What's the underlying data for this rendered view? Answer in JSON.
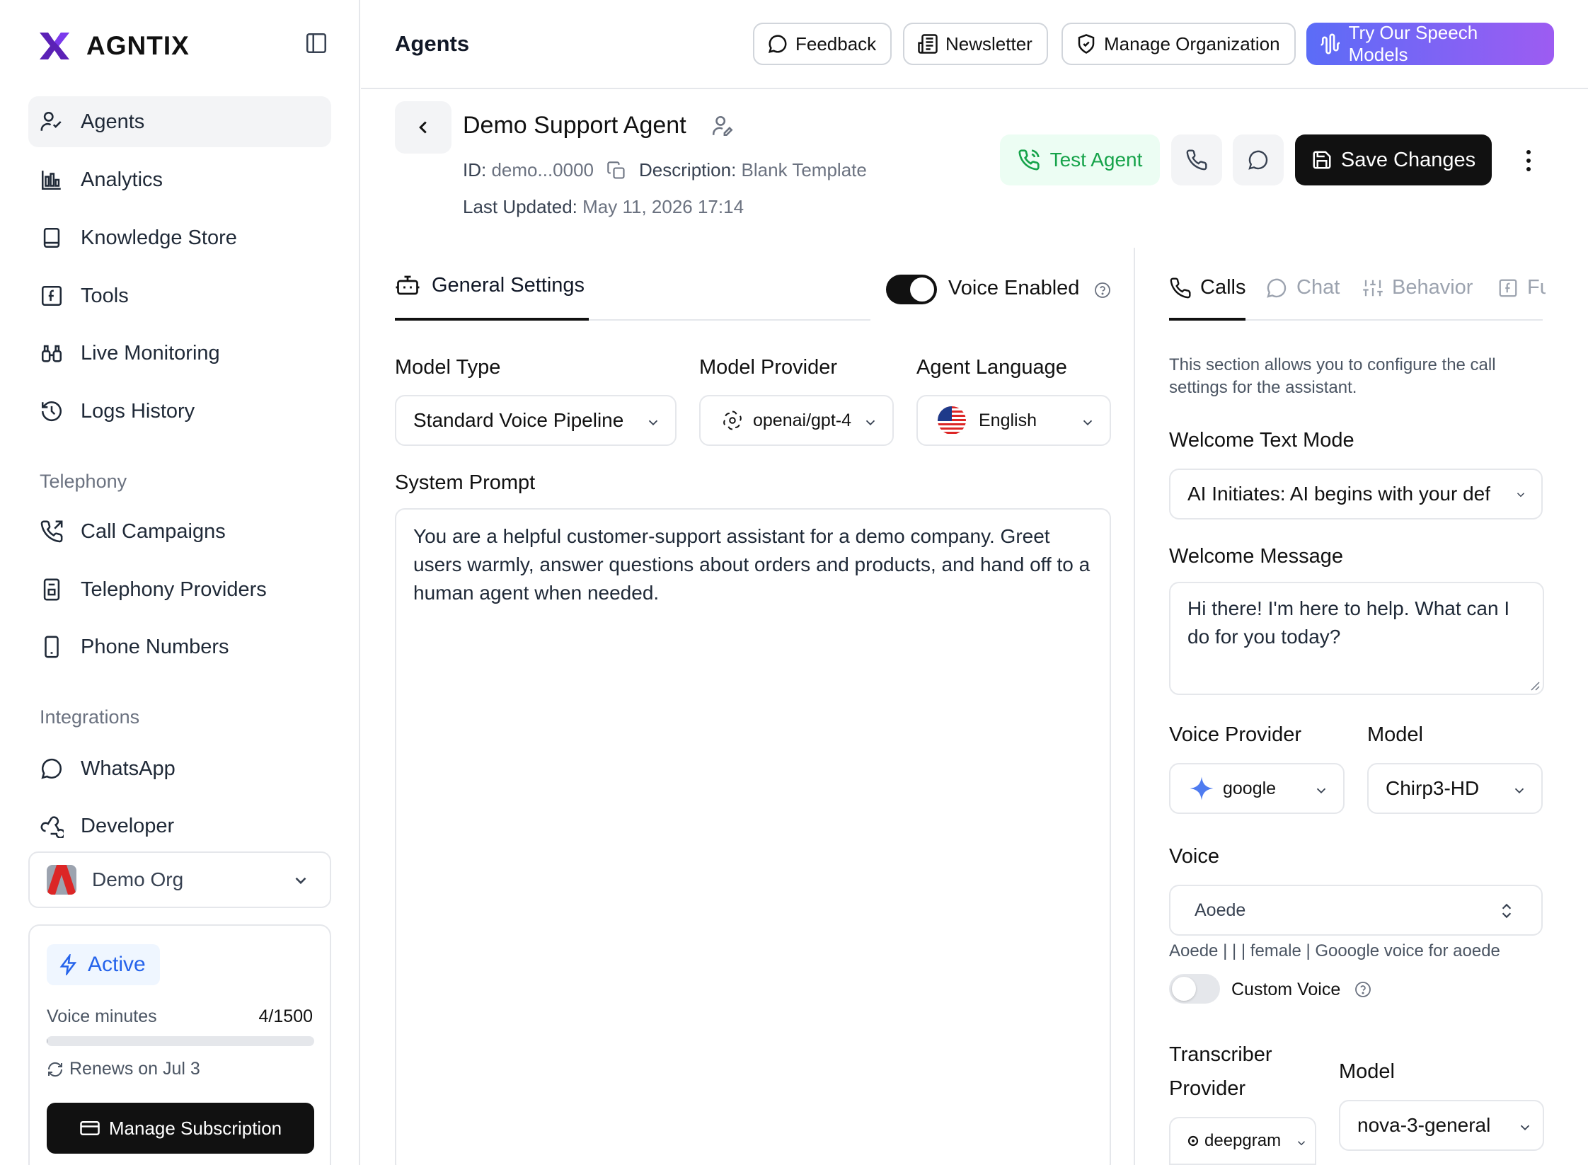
{
  "brand": {
    "name": "AGNTIX"
  },
  "sidebar": {
    "items": [
      {
        "label": "Agents",
        "icon": "agents-icon"
      },
      {
        "label": "Analytics",
        "icon": "analytics-icon"
      },
      {
        "label": "Knowledge Store",
        "icon": "book-icon"
      },
      {
        "label": "Tools",
        "icon": "function-icon"
      },
      {
        "label": "Live Monitoring",
        "icon": "binoculars-icon"
      },
      {
        "label": "Logs History",
        "icon": "history-icon"
      }
    ],
    "telephony_label": "Telephony",
    "telephony": [
      {
        "label": "Call Campaigns",
        "icon": "phone-outgoing-icon"
      },
      {
        "label": "Telephony Providers",
        "icon": "building-icon"
      },
      {
        "label": "Phone Numbers",
        "icon": "smartphone-icon"
      }
    ],
    "integrations_label": "Integrations",
    "integrations": [
      {
        "label": "WhatsApp",
        "icon": "chat-icon"
      },
      {
        "label": "Developer",
        "icon": "webhook-icon"
      }
    ],
    "org": {
      "name": "Demo Org"
    },
    "plan": {
      "status": "Active",
      "voice_label": "Voice minutes",
      "voice_value": "4/1500",
      "voice_fraction": 0.0027,
      "renews": "Renews on Jul 3",
      "manage_label": "Manage Subscription"
    }
  },
  "header": {
    "title": "Agents",
    "buttons": {
      "feedback": "Feedback",
      "newsletter": "Newsletter",
      "manage_org": "Manage Organization",
      "speech": "Try Our Speech Models"
    }
  },
  "agent": {
    "name": "Demo Support Agent",
    "id_label": "ID:",
    "id_value": "demo...0000",
    "desc_label": "Description:",
    "desc_value": "Blank Template",
    "updated_label": "Last Updated:",
    "updated_value": "May 11, 2026 17:14",
    "test_label": "Test Agent",
    "save_label": "Save Changes"
  },
  "general": {
    "tab_label": "General Settings",
    "voice_enabled_label": "Voice Enabled",
    "voice_enabled": true,
    "model_type_label": "Model Type",
    "model_type_value": "Standard Voice Pipeline",
    "model_provider_label": "Model Provider",
    "model_provider_value": "openai/gpt-4",
    "language_label": "Agent Language",
    "language_value": "English",
    "prompt_label": "System Prompt",
    "prompt_value": "You are a helpful customer-support assistant for a demo company. Greet users warmly, answer questions about orders and products, and hand off to a human agent when needed."
  },
  "right": {
    "tabs": [
      {
        "label": "Calls",
        "icon": "phone-icon"
      },
      {
        "label": "Chat",
        "icon": "chat-icon"
      },
      {
        "label": "Behavior",
        "icon": "sliders-icon"
      },
      {
        "label": "Fu",
        "icon": "function-icon"
      }
    ],
    "description": "This section allows you to configure the call settings for the assistant.",
    "welcome_mode_label": "Welcome Text Mode",
    "welcome_mode_value": "AI Initiates: AI begins with your def",
    "welcome_msg_label": "Welcome Message",
    "welcome_msg_value": "Hi there! I'm here to help. What can I do for you today?",
    "voice_provider_label": "Voice Provider",
    "voice_provider_value": "google",
    "voice_model_label": "Model",
    "voice_model_value": "Chirp3-HD",
    "voice_label": "Voice",
    "voice_value": "Aoede",
    "voice_hint": "Aoede | | | female | Gooogle voice for aoede",
    "custom_voice_label": "Custom Voice",
    "custom_voice": false,
    "transcriber_label_1": "Transcriber",
    "transcriber_label_2": "Provider",
    "transcriber_value": "deepgram",
    "trans_model_label": "Model",
    "trans_model_value": "nova-3-general"
  },
  "colors": {
    "accent": "#7c3aed",
    "success": "#16a34a",
    "active_badge": "#2563eb"
  }
}
